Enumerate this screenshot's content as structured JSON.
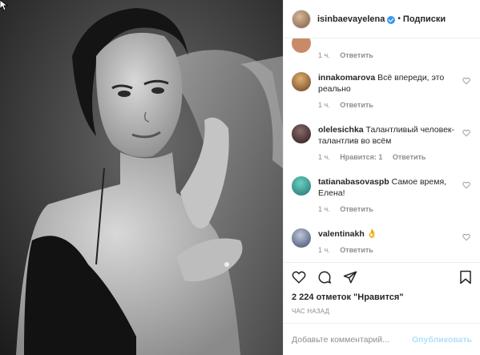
{
  "header": {
    "username": "isinbaevayelena",
    "dot": "•",
    "follow_label": "Подписки"
  },
  "comments": [
    {
      "username": "",
      "text": "",
      "time": "1 ч.",
      "likes": "",
      "reply": "Ответить",
      "avatar_color": "#c98a6a"
    },
    {
      "username": "innakomarova",
      "text": "Всё впереди, это реально",
      "time": "1 ч.",
      "likes": "",
      "reply": "Ответить",
      "avatar_color": "#a07040"
    },
    {
      "username": "olelesichka",
      "text": "Талантливый человек- талантлив во всём",
      "time": "1 ч.",
      "likes": "Нравится: 1",
      "reply": "Ответить",
      "avatar_color": "#4a3a3a"
    },
    {
      "username": "tatianabasovaspb",
      "text": "Самое время, Елена!",
      "time": "1 ч.",
      "likes": "",
      "reply": "Ответить",
      "avatar_color": "#3aa0a0"
    },
    {
      "username": "valentinakh",
      "text": "👌",
      "time": "1 ч.",
      "likes": "",
      "reply": "Ответить",
      "avatar_color": "#6b7d9a"
    }
  ],
  "actions": {
    "like_icon": "heart-icon",
    "comment_icon": "comment-icon",
    "share_icon": "share-icon",
    "save_icon": "bookmark-icon"
  },
  "likes_text": "2 224 отметок \"Нравится\"",
  "timestamp": "ЧАС НАЗАД",
  "add_comment": {
    "placeholder": "Добавьте комментарий...",
    "publish_label": "Опубликовать"
  }
}
